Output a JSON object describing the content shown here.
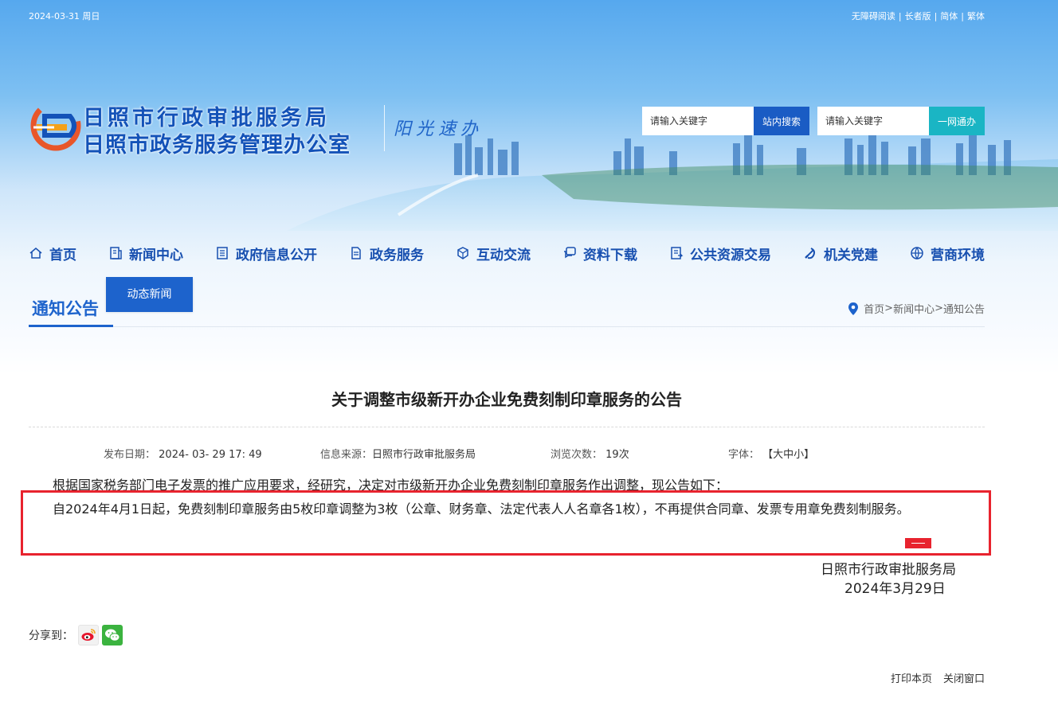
{
  "topbar": {
    "date": "2024-03-31 周日",
    "links": [
      "无障碍阅读",
      "长者版",
      "简体",
      "繁体"
    ]
  },
  "header": {
    "logo_line1": "日照市行政审批服务局",
    "logo_line2": "日照市政务服务管理办公室",
    "slogan": "阳光速办",
    "search_site": {
      "placeholder": "请输入关键字",
      "button": "站内搜索"
    },
    "search_all": {
      "placeholder": "请输入关键字",
      "button": "一网通办"
    }
  },
  "nav": {
    "items": [
      {
        "label": "首页",
        "icon": "home-icon"
      },
      {
        "label": "新闻中心",
        "icon": "news-icon"
      },
      {
        "label": "政府信息公开",
        "icon": "document-icon"
      },
      {
        "label": "政务服务",
        "icon": "service-icon"
      },
      {
        "label": "互动交流",
        "icon": "interact-icon"
      },
      {
        "label": "资料下载",
        "icon": "download-icon"
      },
      {
        "label": "公共资源交易",
        "icon": "trade-icon"
      },
      {
        "label": "机关党建",
        "icon": "party-icon"
      },
      {
        "label": "营商环境",
        "icon": "globe-icon"
      }
    ],
    "submenu": "动态新闻"
  },
  "section": {
    "title": "通知公告",
    "breadcrumb": [
      "首页",
      "新闻中心",
      "通知公告"
    ]
  },
  "article": {
    "title": "关于调整市级新开办企业免费刻制印章服务的公告",
    "meta": {
      "date_label": "发布日期：",
      "date_value": "2024- 03- 29 17: 49",
      "source_label": "信息来源：",
      "source_value": "日照市行政审批服务局",
      "views_label": "浏览次数：",
      "views_value": "19次",
      "font_label": "字体：",
      "font_value": "【大中小】"
    },
    "paragraph1": "根据国家税务部门电子发票的推广应用要求，经研究，决定对市级新开办企业免费刻制印章服务作出调整，现公告如下：",
    "paragraph2": "自2024年4月1日起，免费刻制印章服务由5枚印章调整为3枚（公章、财务章、法定代表人人名章各1枚），不再提供合同章、发票专用章免费刻制服务。",
    "signature": "日照市行政审批服务局",
    "sign_date": "2024年3月29日"
  },
  "share": {
    "label": "分享到："
  },
  "footer_links": [
    "打印本页",
    "关闭窗口"
  ],
  "colors": {
    "accent": "#1d63cc",
    "highlight": "#e8232e",
    "search_btn": "#1a5cc4",
    "portal_btn": "#1ab5c4"
  }
}
